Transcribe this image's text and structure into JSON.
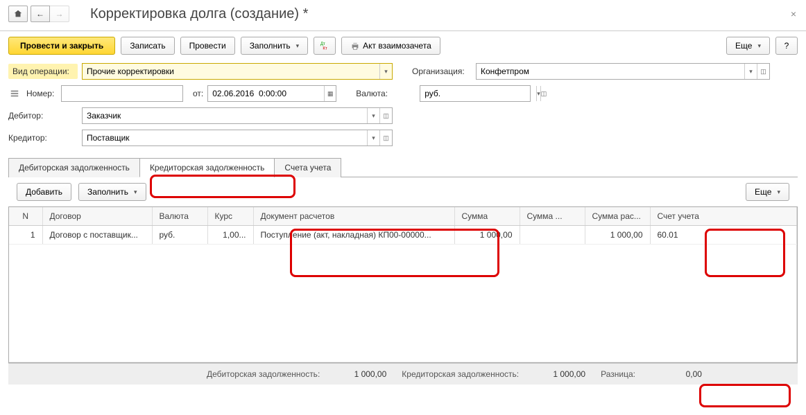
{
  "title": "Корректировка долга (создание) *",
  "toolbar": {
    "submit_close": "Провести и закрыть",
    "save": "Записать",
    "submit": "Провести",
    "fill": "Заполнить",
    "act": "Акт взаимозачета",
    "more": "Еще"
  },
  "fields": {
    "operation_label": "Вид операции:",
    "operation_value": "Прочие корректировки",
    "org_label": "Организация:",
    "org_value": "Конфетпром",
    "number_label": "Номер:",
    "number_value": "",
    "from_label": "от:",
    "date_value": "02.06.2016  0:00:00",
    "currency_label": "Валюта:",
    "currency_value": "руб.",
    "debtor_label": "Дебитор:",
    "debtor_value": "Заказчик",
    "creditor_label": "Кредитор:",
    "creditor_value": "Поставщик"
  },
  "tabs": {
    "t1": "Дебиторская задолженность",
    "t2": "Кредиторская задолженность",
    "t3": "Счета учета"
  },
  "subtoolbar": {
    "add": "Добавить",
    "fill": "Заполнить",
    "more": "Еще"
  },
  "table": {
    "headers": {
      "n": "N",
      "contract": "Договор",
      "currency": "Валюта",
      "rate": "Курс",
      "document": "Документ расчетов",
      "sum": "Сумма",
      "sum2": "Сумма ...",
      "sum3": "Сумма рас...",
      "account": "Счет учета"
    },
    "row": {
      "n": "1",
      "contract": "Договор с поставщик...",
      "currency": "руб.",
      "rate": "1,00...",
      "document": "Поступление (акт, накладная) КП00-00000...",
      "sum": "1 000,00",
      "sum2": "",
      "sum3": "1 000,00",
      "account": "60.01"
    }
  },
  "footer": {
    "deb_label": "Дебиторская задолженность:",
    "deb_value": "1 000,00",
    "cred_label": "Кредиторская задолженность:",
    "cred_value": "1 000,00",
    "diff_label": "Разница:",
    "diff_value": "0,00"
  }
}
